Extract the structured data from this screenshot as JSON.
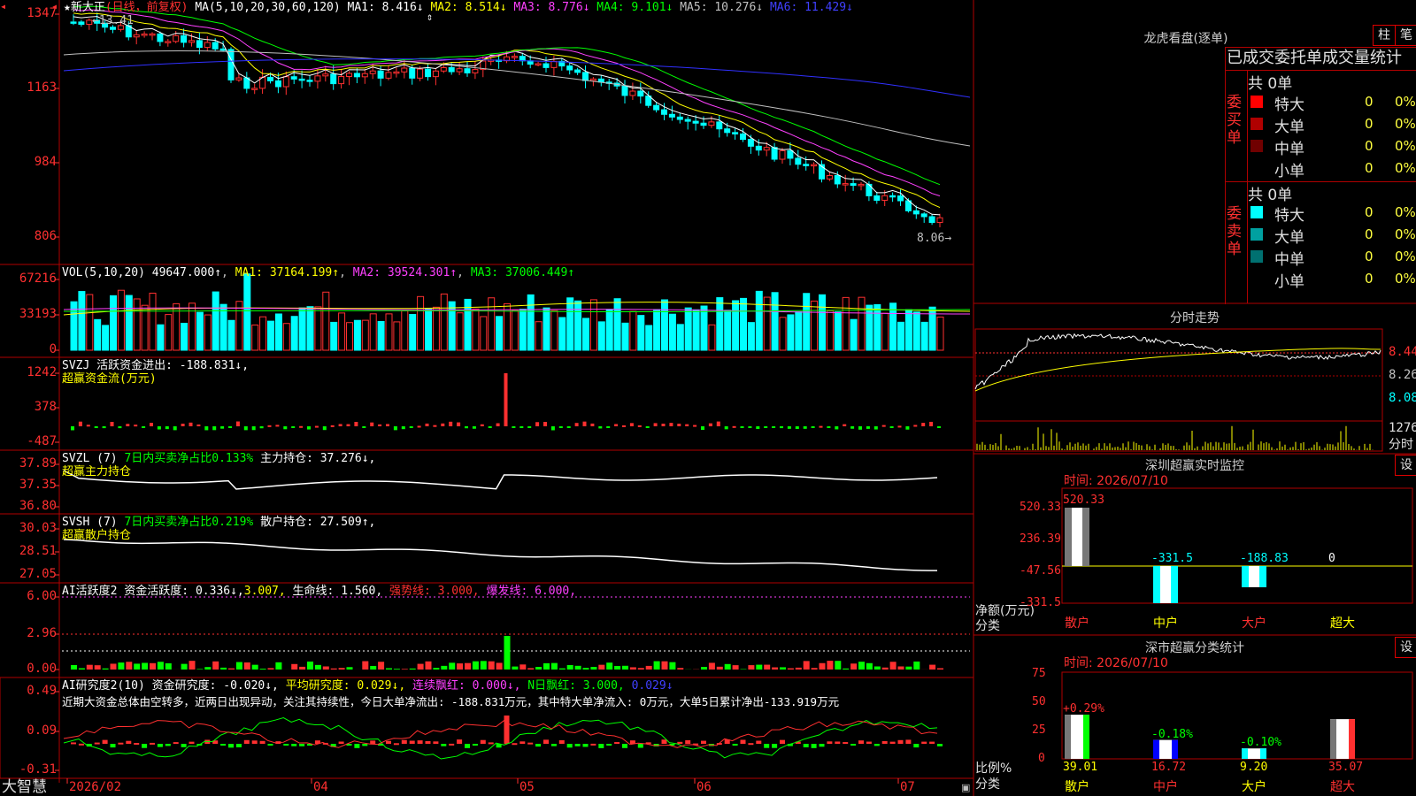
{
  "app": {
    "brand": "大智慧",
    "star": "★"
  },
  "stock": {
    "name": "新大正",
    "period": "(日线，前复权)",
    "high_mark": "13.41",
    "low_mark": "8.06"
  },
  "main_chart": {
    "ma_label": "MA(5,10,20,30,60,120)",
    "ma": [
      {
        "label": "MA1:",
        "value": "8.416",
        "color": "#ffffff",
        "arrow": "↓"
      },
      {
        "label": "MA2:",
        "value": "8.514",
        "color": "#ffff00",
        "arrow": "↓"
      },
      {
        "label": "MA3:",
        "value": "8.776",
        "color": "#ff40ff",
        "arrow": "↓"
      },
      {
        "label": "MA4:",
        "value": "9.101",
        "color": "#00ff00",
        "arrow": "↓"
      },
      {
        "label": "MA5:",
        "value": "10.276",
        "color": "#c0c0c0",
        "arrow": "↓"
      },
      {
        "label": "MA6:",
        "value": "11.429",
        "color": "#4040ff",
        "arrow": "↓"
      }
    ],
    "y_ticks": [
      "1347",
      "1163",
      "984",
      "806"
    ]
  },
  "vol": {
    "label": "VOL(5,10,20)",
    "value": "49647.000↑",
    "ma1": "MA1: 37164.199↑",
    "ma2": "MA2: 39524.301↑",
    "ma3": "MA3: 37006.449↑",
    "y_ticks": [
      "67216",
      "33193",
      "0"
    ]
  },
  "svzj": {
    "label": "SVZJ  活跃资金进出: -188.831↓,",
    "sub": "超赢资金流(万元)",
    "y_ticks": [
      "1242",
      "378",
      "-487"
    ]
  },
  "svzl": {
    "label": "SVZL (7)",
    "ratio": "7日内买卖净占比0.133%",
    "hold": "主力持仓: 37.276↓,",
    "sub": "超赢主力持仓",
    "y_ticks": [
      "37.89",
      "37.35",
      "36.80"
    ]
  },
  "svsh": {
    "label": "SVSH (7)",
    "ratio": "7日内买卖净占比0.219%",
    "hold": "散户持仓: 27.509↑,",
    "sub": "超赢散户持仓",
    "y_ticks": [
      "30.03",
      "28.51",
      "27.05"
    ]
  },
  "ai_active": {
    "label": "AI活跃度2 资金活跃度: 0.336↓,",
    "v2": "3.007,",
    "life": "生命线: 1.560,",
    "strong": "强势线: 3.000,",
    "burst": "爆发线: 6.000,",
    "y_ticks": [
      "6.00",
      "2.96",
      "0.00"
    ]
  },
  "ai_research": {
    "label": "AI研究度2(10) 资金研究度: -0.020↓,",
    "avg": "平均研究度: 0.029↓,",
    "lian": "连续飘红: 0.000↓,",
    "nday": "N日飘红: 3.000,",
    "tail": "0.029↓",
    "comment": "近期大资金总体由空转多，近两日出现异动，关注其持续性，今日大单净流出: -188.831万元，其中特大单净流入: 0万元，大单5日累计净出-133.919万元",
    "y_ticks": [
      "0.49",
      "0.09",
      "-0.31"
    ]
  },
  "x_axis": [
    "2026/02",
    "04",
    "05",
    "06",
    "07"
  ],
  "right": {
    "lhb_title": "龙虎看盘(逐单)",
    "btn_zhu": "柱",
    "btn_bi": "笔",
    "stats_title": "已成交委托单成交量统计",
    "buy": {
      "side": "委买单",
      "total": "共 0单",
      "rows": [
        {
          "name": "特大",
          "color": "#ff0000",
          "count": "0",
          "pct": "0%"
        },
        {
          "name": "大单",
          "color": "#b00000",
          "count": "0",
          "pct": "0%"
        },
        {
          "name": "中单",
          "color": "#700000",
          "count": "0",
          "pct": "0%"
        },
        {
          "name": "小单",
          "color": "#000000",
          "count": "0",
          "pct": "0%"
        }
      ]
    },
    "sell": {
      "side": "委卖单",
      "total": "共 0单",
      "rows": [
        {
          "name": "特大",
          "color": "#00ffff",
          "count": "0",
          "pct": "0%"
        },
        {
          "name": "大单",
          "color": "#00a0a0",
          "count": "0",
          "pct": "0%"
        },
        {
          "name": "中单",
          "color": "#007070",
          "count": "0",
          "pct": "0%"
        },
        {
          "name": "小单",
          "color": "#000000",
          "count": "0",
          "pct": "0%"
        }
      ]
    },
    "intraday_title": "分时走势",
    "intraday_ticks": [
      "8.44",
      "8.26",
      "8.08"
    ],
    "intraday_vol": "1276",
    "intraday_vol_label": "分时",
    "monitor_title": "深圳超赢实时监控",
    "monitor_btn": "设",
    "monitor_time": "时间: 2026/07/10",
    "monitor_ticks": [
      "520.33",
      "236.39",
      "-47.56",
      "-331.5"
    ],
    "monitor_y_label": "净额(万元)",
    "monitor_x_label": "分类",
    "monitor_bars": [
      {
        "cat": "散户",
        "value": 520.33,
        "label": "520.33"
      },
      {
        "cat": "中户",
        "value": -331.5,
        "label": "-331.5"
      },
      {
        "cat": "大户",
        "value": -188.83,
        "label": "-188.83"
      },
      {
        "cat": "超大",
        "value": 0,
        "label": "0"
      }
    ],
    "class_title": "深市超赢分类统计",
    "class_btn": "设",
    "class_time": "时间: 2026/07/10",
    "class_ticks": [
      "75",
      "50",
      "25",
      "0"
    ],
    "class_y_label": "比例%",
    "class_x_label": "分类",
    "class_bars": [
      {
        "cat": "散户",
        "value": 39.01,
        "label": "39.01",
        "delta": "+0.29%",
        "cat_color": "#ffff00",
        "delta_color": "#ff3030"
      },
      {
        "cat": "中户",
        "value": 16.72,
        "label": "16.72",
        "delta": "-0.18%",
        "cat_color": "#ff3030",
        "delta_color": "#00ff00"
      },
      {
        "cat": "大户",
        "value": 9.2,
        "label": "9.20",
        "delta": "-0.10%",
        "cat_color": "#ffff00",
        "delta_color": "#00ff00"
      },
      {
        "cat": "超大",
        "value": 35.07,
        "label": "35.07",
        "delta": "",
        "cat_color": "#ff3030",
        "delta_color": "#00ff00"
      }
    ]
  }
}
